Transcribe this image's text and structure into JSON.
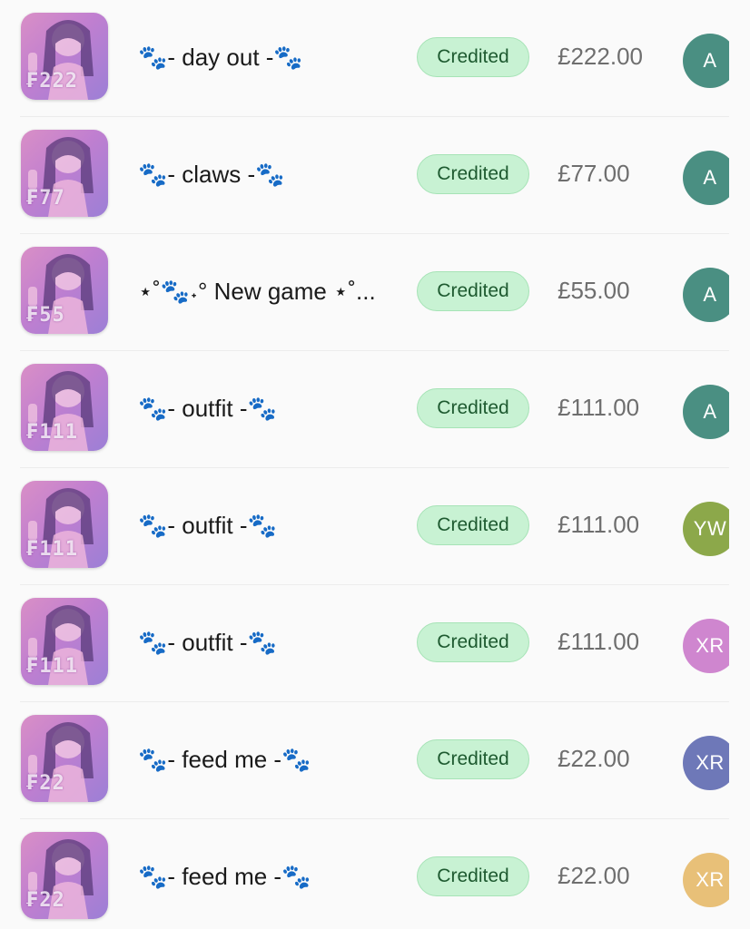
{
  "transactions": [
    {
      "thumb_amount": "₣222",
      "title": "🐾- day out -🐾",
      "status": "Credited",
      "amount": "£222.00",
      "avatar": {
        "initials": "A",
        "color": "#4a8f82"
      }
    },
    {
      "thumb_amount": "₣77",
      "title": "🐾- claws -🐾",
      "status": "Credited",
      "amount": "£77.00",
      "avatar": {
        "initials": "A",
        "color": "#4a8f82"
      }
    },
    {
      "thumb_amount": "₣55",
      "title": "⋆˚🐾˖° New game ⋆˚...",
      "status": "Credited",
      "amount": "£55.00",
      "avatar": {
        "initials": "A",
        "color": "#4a8f82"
      }
    },
    {
      "thumb_amount": "₣111",
      "title": "🐾- outfit -🐾",
      "status": "Credited",
      "amount": "£111.00",
      "avatar": {
        "initials": "A",
        "color": "#4a8f82"
      }
    },
    {
      "thumb_amount": "₣111",
      "title": "🐾- outfit -🐾",
      "status": "Credited",
      "amount": "£111.00",
      "avatar": {
        "initials": "YW",
        "color": "#8ca84a"
      }
    },
    {
      "thumb_amount": "₣111",
      "title": "🐾- outfit -🐾",
      "status": "Credited",
      "amount": "£111.00",
      "avatar": {
        "initials": "XR",
        "color": "#cf86cf"
      }
    },
    {
      "thumb_amount": "₣22",
      "title": "🐾- feed me -🐾",
      "status": "Credited",
      "amount": "£22.00",
      "avatar": {
        "initials": "XR",
        "color": "#6e78b8"
      }
    },
    {
      "thumb_amount": "₣22",
      "title": "🐾- feed me -🐾",
      "status": "Credited",
      "amount": "£22.00",
      "avatar": {
        "initials": "XR",
        "color": "#e8c078"
      }
    }
  ]
}
